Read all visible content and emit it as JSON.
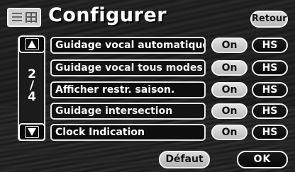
{
  "header": {
    "title": "Configurer",
    "menu_icon": "menu-grid-icon",
    "retour_label": "Retour"
  },
  "pager": {
    "current": "2",
    "separator": "/",
    "total": "4",
    "up_icon": "triangle-up-icon",
    "down_icon": "triangle-down-icon"
  },
  "settings": [
    {
      "label": "Guidage vocal automatique",
      "on_label": "On",
      "hs_label": "HS",
      "selected": "On"
    },
    {
      "label": "Guidage vocal tous modes",
      "on_label": "On",
      "hs_label": "HS",
      "selected": "On"
    },
    {
      "label": "Afficher restr. saison.",
      "on_label": "On",
      "hs_label": "HS",
      "selected": "On"
    },
    {
      "label": "Guidage intersection",
      "on_label": "On",
      "hs_label": "HS",
      "selected": "On"
    },
    {
      "label": "Clock Indication",
      "on_label": "On",
      "hs_label": "HS",
      "selected": "On"
    }
  ],
  "footer": {
    "default_label": "Défaut",
    "ok_label": "OK"
  },
  "colors": {
    "background": "#202020",
    "button_light": "#d0d0d0",
    "button_dark": "#0e0e0e",
    "text_light": "#ffffff"
  }
}
